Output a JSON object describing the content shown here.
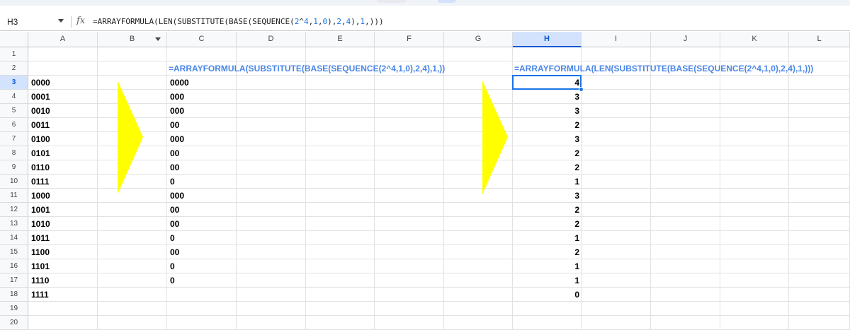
{
  "name_box": {
    "value": "H3"
  },
  "formula_bar": {
    "fx_label": "fx",
    "formula_prefix": "=ARRAYFORMULA(LEN(SUBSTITUTE(BASE(SEQUENCE(",
    "formula_num1": "2",
    "formula_mid1": "^",
    "formula_num2": "4",
    "formula_mid2": ",",
    "formula_num3": "1",
    "formula_mid3": ",",
    "formula_num4": "0",
    "formula_mid4": "),",
    "formula_num5": "2",
    "formula_mid5": ",",
    "formula_num6": "4",
    "formula_mid6": "),",
    "formula_num7": "1",
    "formula_suffix": ",)))"
  },
  "columns": [
    "A",
    "B",
    "C",
    "D",
    "E",
    "F",
    "G",
    "H",
    "I",
    "J",
    "K",
    "L"
  ],
  "selected_column": "H",
  "rows": [
    "1",
    "2",
    "3",
    "4",
    "5",
    "6",
    "7",
    "8",
    "9",
    "10",
    "11",
    "12",
    "13",
    "14",
    "15",
    "16",
    "17",
    "18",
    "19",
    "20"
  ],
  "selected_row": "3",
  "formulas": {
    "C2": "=ARRAYFORMULA(SUBSTITUTE(BASE(SEQUENCE(2^4,1,0),2,4),1,))",
    "H2": "=ARRAYFORMULA(LEN(SUBSTITUTE(BASE(SEQUENCE(2^4,1,0),2,4),1,)))"
  },
  "column_a": [
    "0000",
    "0001",
    "0010",
    "0011",
    "0100",
    "0101",
    "0110",
    "0111",
    "1000",
    "1001",
    "1010",
    "1011",
    "1100",
    "1101",
    "1110",
    "1111"
  ],
  "column_c": [
    "0000",
    "000",
    "000",
    "00",
    "000",
    "00",
    "00",
    "0",
    "000",
    "00",
    "00",
    "0",
    "00",
    "0",
    "0",
    ""
  ],
  "column_h": [
    "4",
    "3",
    "3",
    "2",
    "3",
    "2",
    "2",
    "1",
    "3",
    "2",
    "2",
    "1",
    "2",
    "1",
    "1",
    "0"
  ],
  "arrow_color": "#ffff00",
  "accent_color": "#1a73e8",
  "formula_text_color": "#4a86e8"
}
